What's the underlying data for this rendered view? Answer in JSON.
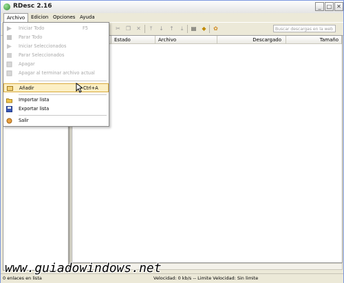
{
  "window": {
    "title": "RDesc 2.16"
  },
  "menubar": [
    "Archivo",
    "Edicion",
    "Opciones",
    "Ayuda"
  ],
  "search": {
    "placeholder": "Buscar descargas en la web"
  },
  "columns": [
    "Estado",
    "Archivo",
    "Descargado",
    "Tamaño"
  ],
  "archivo_menu": {
    "items": [
      {
        "label": "Iniciar Todo",
        "shortcut": "F5",
        "disabled": true,
        "icon": "play-icon"
      },
      {
        "label": "Parar Todo",
        "shortcut": "",
        "disabled": true,
        "icon": "stop-icon"
      },
      {
        "label": "Iniciar Seleccionados",
        "shortcut": "",
        "disabled": true,
        "icon": "play-selected-icon"
      },
      {
        "label": "Parar Seleccionados",
        "shortcut": "",
        "disabled": true,
        "icon": "stop-selected-icon"
      },
      {
        "label": "Apagar",
        "shortcut": "",
        "disabled": true,
        "icon": "power-icon"
      },
      {
        "label": "Apagar al terminar archivo actual",
        "shortcut": "",
        "disabled": true,
        "icon": "power-after-icon"
      },
      {
        "label": "Añadir",
        "shortcut": "Ctrl+A",
        "disabled": false,
        "highlighted": true,
        "icon": "add-link-icon"
      },
      {
        "label": "Importar lista",
        "shortcut": "",
        "disabled": false,
        "icon": "folder-open-icon"
      },
      {
        "label": "Exportar lista",
        "shortcut": "",
        "disabled": false,
        "icon": "save-disk-icon"
      },
      {
        "label": "Salir",
        "shortcut": "",
        "disabled": false,
        "icon": "exit-icon"
      }
    ]
  },
  "status": {
    "left": "0 enlaces en lista",
    "right": "Velocidad: 0 kb/s  --  Limite Velocidad: Sin limite"
  },
  "watermark": "www.guiadowindows.net",
  "colors": {
    "highlight_bg": "#fcefc4",
    "highlight_border": "#d8a93a",
    "disabled_text": "#a7a7a7"
  }
}
